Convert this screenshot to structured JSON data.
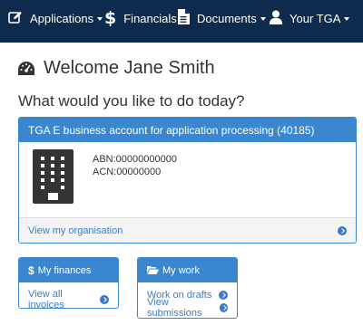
{
  "nav": {
    "applications": "Applications",
    "financials": "Financials",
    "documents": "Documents",
    "your_tga": "Your TGA",
    "dollar": "$"
  },
  "welcome": "Welcome Jane Smith",
  "question": "What would you like to do today?",
  "org": {
    "title": "TGA E business account for application processing (40185)",
    "abn": "ABN:00000000000",
    "acn": "ACN:00000000",
    "view_link": "View my organisation"
  },
  "finances": {
    "icon": "$",
    "title": "My finances",
    "link": "View all invoices"
  },
  "work": {
    "title": "My work",
    "drafts_link": "Work on drafts",
    "submissions_link": "View submissions"
  },
  "colors": {
    "navbar": "#0e2b4d",
    "accent": "#3a87cf",
    "link": "#3f7cbf"
  }
}
